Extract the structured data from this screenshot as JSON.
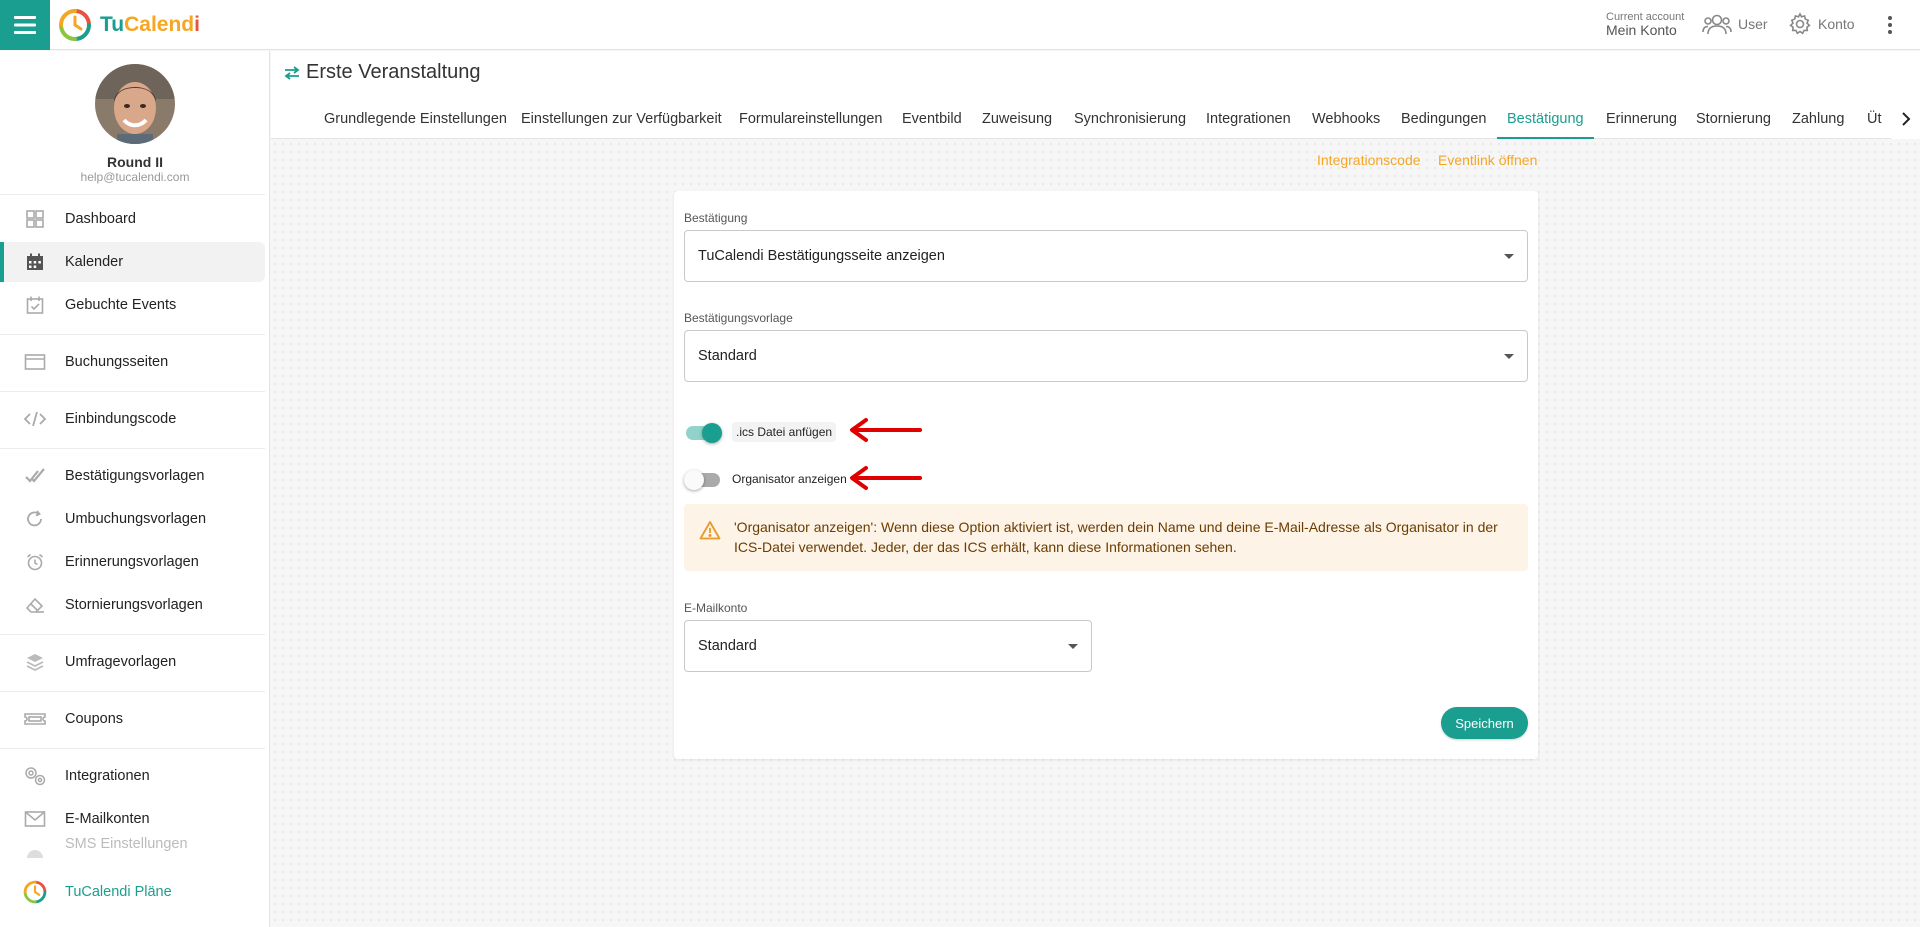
{
  "app": {
    "logo_text": "TuCalendi",
    "logo_parts": [
      "Tu",
      "Calend",
      "i"
    ]
  },
  "topbar": {
    "account_caption": "Current account",
    "account_name": "Mein Konto",
    "user_label": "User",
    "konto_label": "Konto"
  },
  "sidebar": {
    "profile": {
      "name": "Round II",
      "email": "help@tucalendi.com"
    },
    "items": [
      {
        "label": "Dashboard",
        "icon": "dashboard-grid-icon"
      },
      {
        "label": "Kalender",
        "icon": "calendar-icon"
      },
      {
        "label": "Gebuchte Events",
        "icon": "calendar-check-icon"
      },
      {
        "label": "Buchungsseiten",
        "icon": "browser-window-icon"
      },
      {
        "label": "Einbindungscode",
        "icon": "code-icon"
      },
      {
        "label": "Bestätigungsvorlagen",
        "icon": "double-check-icon"
      },
      {
        "label": "Umbuchungsvorlagen",
        "icon": "refresh-icon"
      },
      {
        "label": "Erinnerungsvorlagen",
        "icon": "alarm-clock-icon"
      },
      {
        "label": "Stornierungsvorlagen",
        "icon": "eraser-icon"
      },
      {
        "label": "Umfragevorlagen",
        "icon": "layers-icon"
      },
      {
        "label": "Coupons",
        "icon": "ticket-icon"
      },
      {
        "label": "Integrationen",
        "icon": "gears-icon"
      },
      {
        "label": "E-Mailkonten",
        "icon": "envelope-icon"
      },
      {
        "label": "SMS Einstellungen",
        "icon": "sms-icon"
      },
      {
        "label": "TuCalendi Pläne",
        "icon": "tucalendi-logo-icon"
      }
    ]
  },
  "header": {
    "title": "Erste Veranstaltung",
    "tabs": [
      "Grundlegende Einstellungen",
      "Einstellungen zur Verfügbarkeit",
      "Formulareinstellungen",
      "Eventbild",
      "Zuweisung",
      "Synchronisierung",
      "Integrationen",
      "Webhooks",
      "Bedingungen",
      "Bestätigung",
      "Erinnerung",
      "Stornierung",
      "Zahlung",
      "Üt"
    ],
    "active_tab": "Bestätigung"
  },
  "links": {
    "integration_code": "Integrationscode",
    "open_event_link": "Eventlink öffnen"
  },
  "form": {
    "confirmation_label": "Bestätigung",
    "confirmation_value": "TuCalendi Bestätigungsseite anzeigen",
    "template_label": "Bestätigungsvorlage",
    "template_value": "Standard",
    "ics_toggle_label": ".ics Datei anfügen",
    "ics_toggle_on": true,
    "organizer_toggle_label": "Organisator anzeigen",
    "organizer_toggle_on": false,
    "alert_text": "'Organisator anzeigen': Wenn diese Option aktiviert ist, werden dein Name und deine E-Mail-Adresse als Organisator in der ICS-Datei verwendet. Jeder, der das ICS erhält, kann diese Informationen sehen.",
    "mail_label": "E-Mailkonto",
    "mail_value": "Standard",
    "save_label": "Speichern"
  },
  "colors": {
    "accent": "#1a9e8f",
    "link": "#f5a623",
    "annotation_arrow": "#e00000",
    "alert_bg": "#fdf3e7"
  }
}
